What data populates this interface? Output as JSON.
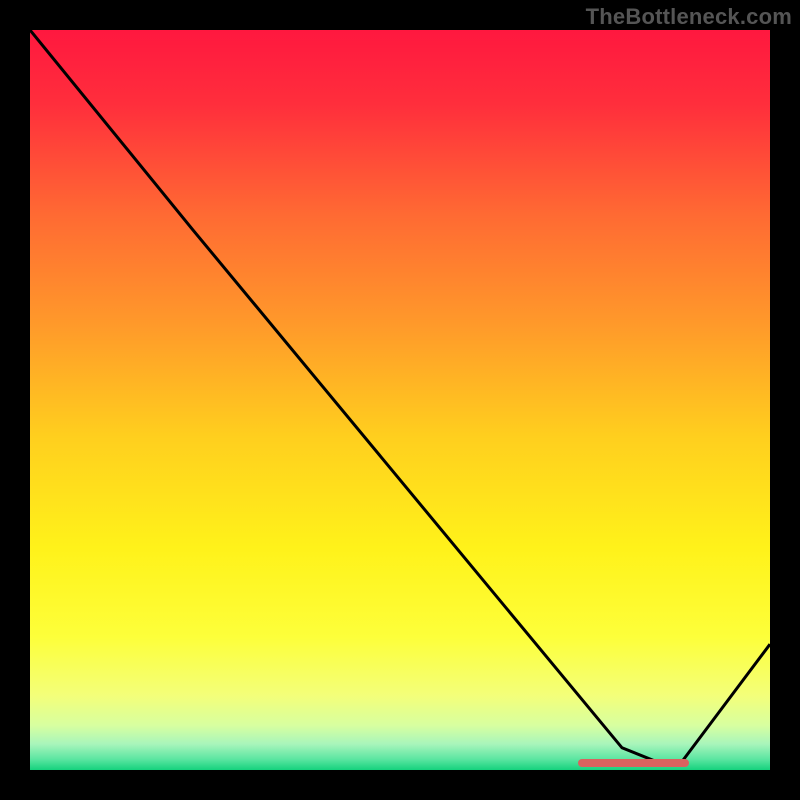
{
  "watermark": "TheBottleneck.com",
  "chart_data": {
    "type": "line",
    "title": "",
    "xlabel": "",
    "ylabel": "",
    "xlim": [
      0,
      100
    ],
    "ylim": [
      0,
      100
    ],
    "x": [
      0,
      22,
      80,
      85,
      88,
      100
    ],
    "values": [
      100,
      73,
      3,
      1,
      1,
      17
    ],
    "line_color": "#000000",
    "background_gradient": {
      "stops": [
        {
          "pos": 0.0,
          "color": "#ff183f"
        },
        {
          "pos": 0.1,
          "color": "#ff2e3c"
        },
        {
          "pos": 0.25,
          "color": "#ff6a33"
        },
        {
          "pos": 0.4,
          "color": "#ff9a2a"
        },
        {
          "pos": 0.55,
          "color": "#ffcf1e"
        },
        {
          "pos": 0.7,
          "color": "#fff21a"
        },
        {
          "pos": 0.82,
          "color": "#fdff3a"
        },
        {
          "pos": 0.9,
          "color": "#f3ff7a"
        },
        {
          "pos": 0.94,
          "color": "#d7ffa0"
        },
        {
          "pos": 0.965,
          "color": "#a8f5bb"
        },
        {
          "pos": 0.985,
          "color": "#5de6a2"
        },
        {
          "pos": 1.0,
          "color": "#15d27d"
        }
      ]
    },
    "highlight_bar": {
      "x_start": 74,
      "x_end": 89,
      "y": 1,
      "color": "#d9635f"
    }
  }
}
